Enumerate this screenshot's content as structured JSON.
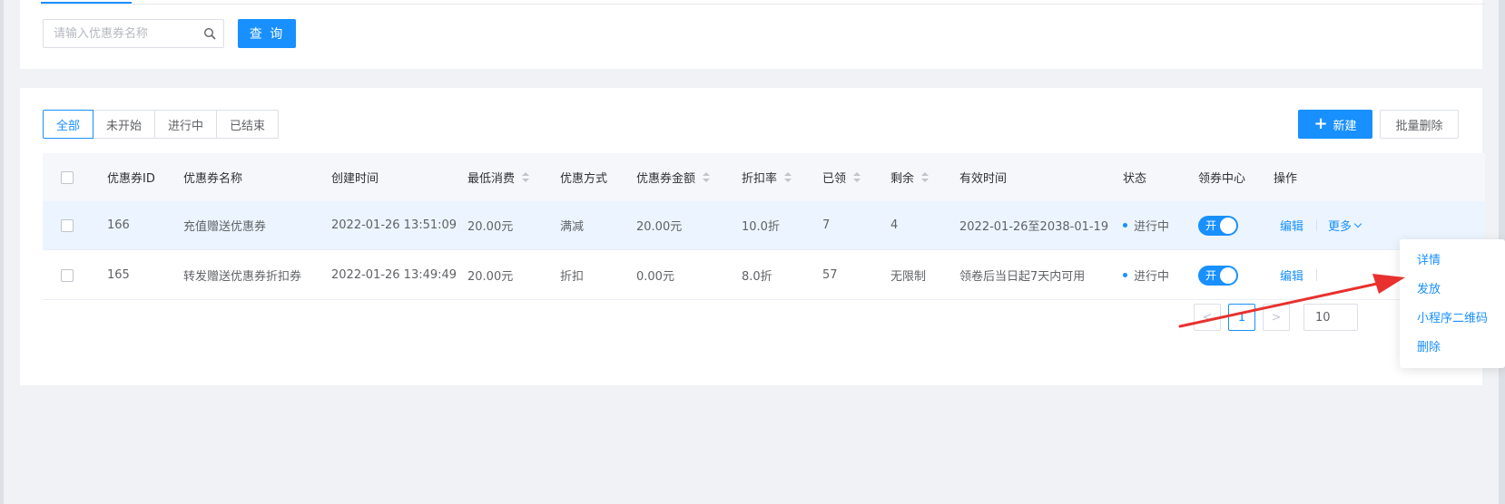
{
  "search": {
    "placeholder": "请输入优惠券名称",
    "button": "查 询"
  },
  "filters": [
    {
      "label": "全部",
      "active": true
    },
    {
      "label": "未开始",
      "active": false
    },
    {
      "label": "进行中",
      "active": false
    },
    {
      "label": "已结束",
      "active": false
    }
  ],
  "toolbar": {
    "new_label": "新建",
    "batch_delete_label": "批量删除"
  },
  "table": {
    "headers": {
      "id": "优惠券ID",
      "name": "优惠券名称",
      "created": "创建时间",
      "min_spend": "最低消费",
      "type": "优惠方式",
      "amount": "优惠券金额",
      "discount": "折扣率",
      "claimed": "已领",
      "remaining": "剩余",
      "valid": "有效时间",
      "status": "状态",
      "center": "领券中心",
      "ops": "操作"
    },
    "rows": [
      {
        "id": "166",
        "name": "充值赠送优惠券",
        "created": "2022-01-26 13:51:09",
        "min_spend": "20.00元",
        "type": "满减",
        "amount": "20.00元",
        "discount": "10.0折",
        "claimed": "7",
        "remaining": "4",
        "valid": "2022-01-26至2038-01-19",
        "status": "进行中",
        "switch": "开",
        "edit": "编辑",
        "more": "更多"
      },
      {
        "id": "165",
        "name": "转发赠送优惠券折扣券",
        "created": "2022-01-26 13:49:49",
        "min_spend": "20.00元",
        "type": "折扣",
        "amount": "0.00元",
        "discount": "8.0折",
        "claimed": "57",
        "remaining": "无限制",
        "valid": "领卷后当日起7天内可用",
        "status": "进行中",
        "switch": "开",
        "edit": "编辑"
      }
    ]
  },
  "pagination": {
    "prev": "<",
    "current": "1",
    "next": ">",
    "size": "10"
  },
  "dropdown": {
    "items": [
      "详情",
      "发放",
      "小程序二维码",
      "删除"
    ]
  },
  "colors": {
    "primary": "#1890ff",
    "annotation_arrow": "#e8312f"
  }
}
